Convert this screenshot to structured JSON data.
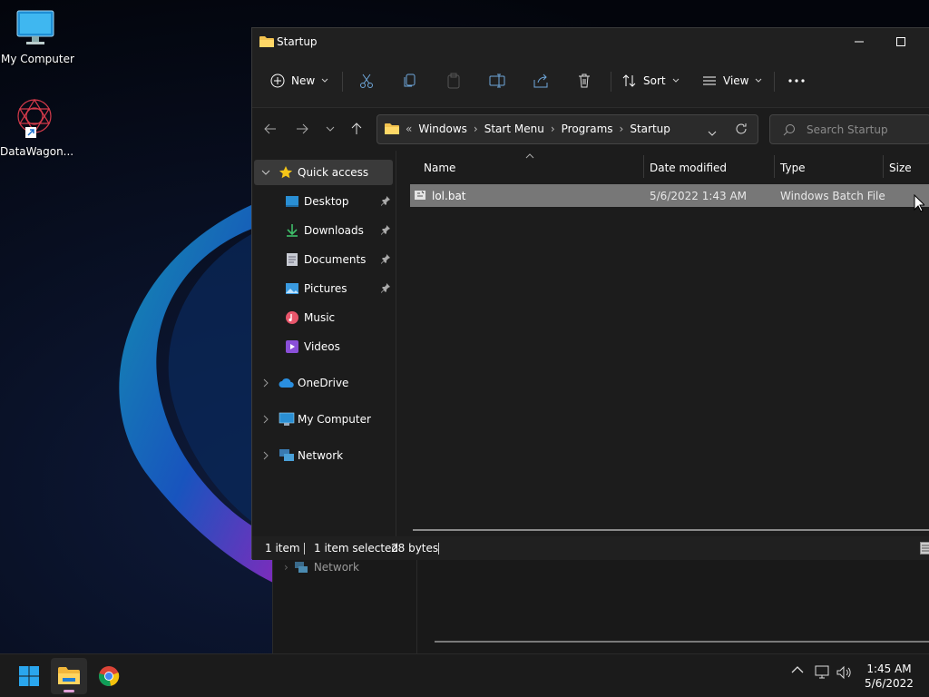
{
  "desktop": {
    "icons": [
      {
        "label": "My Computer"
      },
      {
        "label": "DataWagon..."
      }
    ]
  },
  "background_window": {
    "network_label": "Network"
  },
  "window": {
    "title": "Startup",
    "toolbar": {
      "new_label": "New",
      "sort_label": "Sort",
      "view_label": "View"
    },
    "address": {
      "overflow": "«",
      "crumbs": [
        "Windows",
        "Start Menu",
        "Programs",
        "Startup"
      ]
    },
    "search": {
      "placeholder": "Search Startup"
    },
    "sidebar": {
      "quick_access": "Quick access",
      "items": [
        {
          "label": "Desktop",
          "icon": "desktop-icon",
          "pinned": true
        },
        {
          "label": "Downloads",
          "icon": "downloads-icon",
          "pinned": true
        },
        {
          "label": "Documents",
          "icon": "documents-icon",
          "pinned": true
        },
        {
          "label": "Pictures",
          "icon": "pictures-icon",
          "pinned": true
        },
        {
          "label": "Music",
          "icon": "music-icon",
          "pinned": false
        },
        {
          "label": "Videos",
          "icon": "videos-icon",
          "pinned": false
        }
      ],
      "roots": [
        {
          "label": "OneDrive",
          "icon": "onedrive-icon"
        },
        {
          "label": "My Computer",
          "icon": "computer-icon"
        },
        {
          "label": "Network",
          "icon": "network-icon"
        }
      ]
    },
    "columns": {
      "name": "Name",
      "date": "Date modified",
      "type": "Type",
      "size": "Size"
    },
    "files": [
      {
        "name": "lol.bat",
        "date": "5/6/2022 1:43 AM",
        "type": "Windows Batch File",
        "selected": true
      }
    ],
    "status": {
      "count": "1 item",
      "selection": "1 item selected",
      "size": "28 bytes"
    }
  },
  "taskbar": {
    "apps": [
      "start-icon",
      "file-explorer-icon",
      "chrome-icon"
    ],
    "clock": {
      "time": "1:45 AM",
      "date": "5/6/2022"
    }
  },
  "colors": {
    "accent_folder": "#f2c24f",
    "selection": "#777777",
    "window_bg": "#1c1c1c",
    "taskbar": "#1b1b1b"
  }
}
